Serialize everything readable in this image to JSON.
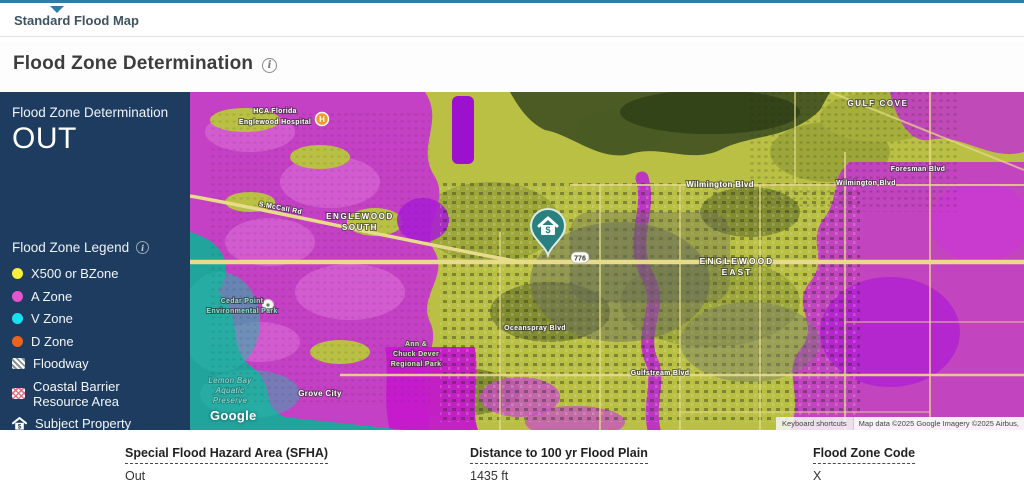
{
  "tab": {
    "label": "Standard Flood Map"
  },
  "header": {
    "title": "Flood Zone Determination",
    "info_icon": "i"
  },
  "panel": {
    "title": "Flood Zone Determination",
    "result": "OUT",
    "legend_title": "Flood Zone Legend",
    "legend": [
      {
        "label": "X500 or BZone",
        "swatch": "dot",
        "color": "#f7ef3c"
      },
      {
        "label": "A Zone",
        "swatch": "dot",
        "color": "#e356cd"
      },
      {
        "label": "V Zone",
        "swatch": "dot",
        "color": "#19e0f0"
      },
      {
        "label": "D Zone",
        "swatch": "dot",
        "color": "#ea6420"
      },
      {
        "label": "Floodway",
        "swatch": "hatch-gray"
      },
      {
        "label": "Coastal Barrier Resource Area",
        "swatch": "hatch-pink"
      },
      {
        "label": "Subject Property",
        "swatch": "house-icon"
      }
    ]
  },
  "map": {
    "google_logo": "Google",
    "attribution_left": "Keyboard shortcuts",
    "attribution_right": "Map data ©2025 Google Imagery ©2025 Airbus,",
    "route_shield": "776",
    "hospital_marker": "H",
    "marker_glyph": "$",
    "labels": [
      {
        "text": "HCA Florida"
      },
      {
        "text": "Englewood Hospital"
      },
      {
        "text": "ENGLEWOOD"
      },
      {
        "text": "SOUTH"
      },
      {
        "text": "S.McCall Rd"
      },
      {
        "text": "Wilmington Blvd"
      },
      {
        "text": "ENGLEWOOD"
      },
      {
        "text": "EAST"
      },
      {
        "text": "GULF COVE"
      },
      {
        "text": "Foresman Blvd"
      },
      {
        "text": "Wilmington Blvd"
      },
      {
        "text": "Cedar Point"
      },
      {
        "text": "Environmental Park"
      },
      {
        "text": "Ann &"
      },
      {
        "text": "Chuck Dever"
      },
      {
        "text": "Regional Park"
      },
      {
        "text": "Oceanspray Blvd"
      },
      {
        "text": "Gulfstream Blvd"
      },
      {
        "text": "Lemon Bay"
      },
      {
        "text": "Aquatic"
      },
      {
        "text": "Preserve"
      },
      {
        "text": "Grove City"
      }
    ]
  },
  "fields": [
    {
      "label": "Special Flood Hazard Area (SFHA)",
      "value": "Out"
    },
    {
      "label": "Distance to 100 yr Flood Plain",
      "value": "1435 ft"
    },
    {
      "label": "Flood Zone Code",
      "value": "X"
    }
  ],
  "colors": {
    "accent_line": "#2f7ca6",
    "panel_bg": "#1e3c5f",
    "zone_x500": "#f7ef3c",
    "zone_a": "#e356cd",
    "zone_v": "#19e0f0",
    "zone_d": "#ea6420",
    "subject_marker": "#2a7f7f"
  }
}
